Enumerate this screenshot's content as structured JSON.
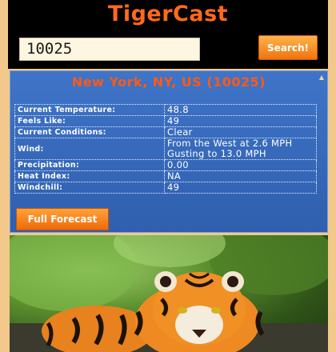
{
  "app": {
    "title": "TigerCast"
  },
  "search": {
    "value": "10025",
    "button_label": "Search!"
  },
  "weather": {
    "location": "New York, NY, US (10025)",
    "rows": [
      {
        "label": "Current Temperature:",
        "value": "48.8"
      },
      {
        "label": "Feels Like:",
        "value": "49"
      },
      {
        "label": "Current Conditions:",
        "value": "Clear"
      },
      {
        "label": "Wind:",
        "value": "From the West at 2.6 MPH Gusting to 13.0 MPH"
      },
      {
        "label": "Precipitation:",
        "value": "0.00"
      },
      {
        "label": "Heat Index:",
        "value": "NA"
      },
      {
        "label": "Windchill:",
        "value": "49"
      }
    ],
    "full_forecast_label": "Full Forecast"
  },
  "colors": {
    "brand_orange": "#ff6a1a",
    "panel_blue": "#3f74c8",
    "page_background": "#f2c98a"
  },
  "photo": {
    "icon": "tiger-photo"
  }
}
